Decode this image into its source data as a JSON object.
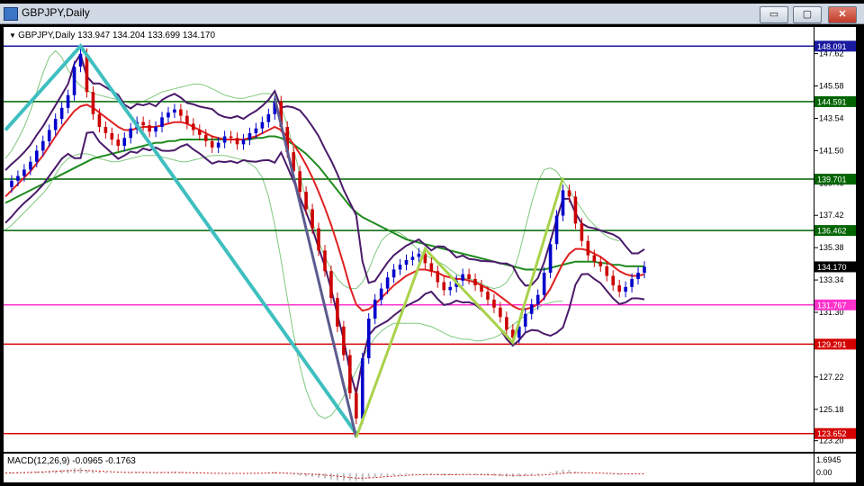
{
  "window": {
    "title": "GBPJPY,Daily",
    "buttons": {
      "minimize": "▭",
      "restore": "▢",
      "close": "✕"
    }
  },
  "chart_info": "GBPJPY,Daily  133.947 134.204 133.699 134.170",
  "macd_info": "MACD(12,26,9) -0.0965 -0.1763",
  "chart_data": {
    "type": "line",
    "symbol": "GBPJPY",
    "timeframe": "Daily",
    "ohlc": {
      "open": 133.947,
      "high": 134.204,
      "low": 133.699,
      "close": 134.17
    },
    "ylim": [
      122.5,
      149.3
    ],
    "price_ticks": [
      147.62,
      145.58,
      143.54,
      141.5,
      139.46,
      137.42,
      135.38,
      133.34,
      131.3,
      127.22,
      125.18,
      123.2
    ],
    "levels": [
      {
        "value": 148.091,
        "color": "#1a1aa0"
      },
      {
        "value": 144.591,
        "color": "#006400"
      },
      {
        "value": 139.701,
        "color": "#006400"
      },
      {
        "value": 136.462,
        "color": "#006400"
      },
      {
        "value": 134.17,
        "color": "#000000"
      },
      {
        "value": 131.767,
        "color": "#ff33cc"
      },
      {
        "value": 129.291,
        "color": "#d40000"
      },
      {
        "value": 123.652,
        "color": "#d40000"
      }
    ],
    "close_series": [
      139.2,
      139.6,
      139.9,
      140.3,
      140.8,
      141.5,
      142.1,
      142.8,
      143.5,
      144.2,
      145.0,
      146.8,
      147.6,
      145.2,
      143.8,
      143.0,
      142.6,
      142.2,
      141.8,
      142.3,
      142.9,
      143.3,
      143.1,
      142.7,
      143.0,
      143.6,
      143.9,
      144.1,
      143.7,
      143.2,
      142.8,
      142.5,
      142.1,
      141.7,
      142.0,
      142.4,
      142.3,
      141.9,
      142.2,
      142.6,
      142.9,
      143.3,
      143.8,
      144.6,
      143.0,
      141.4,
      140.2,
      138.9,
      137.8,
      136.6,
      135.2,
      133.9,
      132.2,
      130.4,
      128.6,
      126.2,
      124.6,
      128.4,
      130.9,
      132.1,
      132.8,
      133.5,
      134.0,
      134.3,
      134.6,
      134.8,
      135.0,
      134.4,
      133.9,
      133.2,
      132.7,
      132.9,
      133.3,
      133.7,
      133.4,
      133.0,
      132.6,
      132.1,
      131.6,
      131.0,
      130.2,
      129.7,
      130.4,
      131.2,
      131.8,
      132.4,
      133.8,
      135.6,
      137.4,
      139.0,
      138.6,
      136.9,
      135.8,
      134.9,
      134.5,
      134.2,
      133.6,
      133.0,
      132.6,
      132.9,
      133.4,
      133.8,
      134.17
    ],
    "ma_fast": [
      138.6,
      139.0,
      139.4,
      139.8,
      140.2,
      140.7,
      141.2,
      141.8,
      142.4,
      143.0,
      143.5,
      144.0,
      144.3,
      144.4,
      144.2,
      143.9,
      143.6,
      143.3,
      143.0,
      142.8,
      142.8,
      142.9,
      143.0,
      143.0,
      143.0,
      143.1,
      143.2,
      143.3,
      143.3,
      143.2,
      143.0,
      142.8,
      142.6,
      142.4,
      142.3,
      142.2,
      142.2,
      142.2,
      142.2,
      142.3,
      142.4,
      142.6,
      142.8,
      143.0,
      142.8,
      142.4,
      141.9,
      141.3,
      140.6,
      139.8,
      138.9,
      137.9,
      136.8,
      135.6,
      134.3,
      132.9,
      131.8,
      131.4,
      131.5,
      131.8,
      132.2,
      132.6,
      133.0,
      133.3,
      133.6,
      133.8,
      134.0,
      134.0,
      133.9,
      133.8,
      133.6,
      133.5,
      133.4,
      133.4,
      133.3,
      133.2,
      133.0,
      132.8,
      132.6,
      132.3,
      132.0,
      131.7,
      131.5,
      131.5,
      131.6,
      131.8,
      132.2,
      132.8,
      133.6,
      134.4,
      135.0,
      135.3,
      135.3,
      135.2,
      135.0,
      134.8,
      134.5,
      134.2,
      133.9,
      133.7,
      133.6,
      133.6,
      133.7
    ],
    "ma_slow": [
      138.2,
      138.4,
      138.6,
      138.8,
      139.0,
      139.2,
      139.4,
      139.6,
      139.8,
      140.0,
      140.2,
      140.4,
      140.6,
      140.8,
      141.0,
      141.1,
      141.2,
      141.3,
      141.4,
      141.5,
      141.6,
      141.7,
      141.8,
      141.9,
      142.0,
      142.0,
      142.1,
      142.1,
      142.2,
      142.2,
      142.2,
      142.2,
      142.2,
      142.2,
      142.2,
      142.2,
      142.2,
      142.2,
      142.2,
      142.2,
      142.3,
      142.3,
      142.4,
      142.4,
      142.3,
      142.1,
      141.9,
      141.6,
      141.3,
      140.9,
      140.5,
      140.0,
      139.5,
      139.0,
      138.5,
      138.0,
      137.6,
      137.3,
      137.1,
      136.9,
      136.7,
      136.5,
      136.3,
      136.1,
      135.9,
      135.8,
      135.7,
      135.6,
      135.5,
      135.4,
      135.3,
      135.2,
      135.1,
      135.0,
      134.9,
      134.8,
      134.7,
      134.6,
      134.5,
      134.4,
      134.3,
      134.2,
      134.1,
      134.0,
      134.0,
      134.0,
      134.0,
      134.1,
      134.2,
      134.3,
      134.4,
      134.5,
      134.5,
      134.5,
      134.5,
      134.4,
      134.4,
      134.3,
      134.3,
      134.2,
      134.2,
      134.2,
      134.2
    ],
    "zigzag": [
      {
        "i": 0,
        "v": 142.8
      },
      {
        "i": 12,
        "v": 148.09
      },
      {
        "i": 56,
        "v": 123.65
      }
    ],
    "zigzag_recent": [
      {
        "i": 43,
        "v": 144.8
      },
      {
        "i": 56,
        "v": 123.4
      }
    ],
    "zigzag_green": [
      {
        "i": 56,
        "v": 123.4
      },
      {
        "i": 67,
        "v": 135.3
      },
      {
        "i": 81,
        "v": 129.4
      },
      {
        "i": 89,
        "v": 139.8
      }
    ],
    "bands_upper": [
      141.0,
      141.5,
      142.2,
      143.0,
      144.0,
      145.2,
      146.4,
      147.4,
      147.8,
      147.4,
      146.6,
      146.0,
      145.6,
      145.3,
      145.1,
      145.0,
      144.9,
      144.8,
      144.7,
      144.6,
      144.5,
      144.5,
      144.6,
      144.8,
      145.0,
      145.2,
      145.3,
      145.4,
      145.5,
      145.6,
      145.7,
      145.7,
      145.6,
      145.4,
      145.2,
      145.0,
      144.9,
      144.8,
      144.8,
      144.9,
      145.0,
      145.1,
      145.1,
      145.0,
      144.3,
      143.1,
      141.6,
      140.0,
      138.4,
      137.0,
      135.8,
      134.8,
      134.0,
      133.4,
      133.0,
      132.8,
      132.8,
      133.2,
      134.0,
      135.0,
      135.8,
      136.2,
      136.4,
      136.3,
      136.0,
      135.6,
      135.2,
      134.9,
      134.7,
      134.5,
      134.3,
      134.0,
      133.7,
      133.5,
      133.4,
      133.3,
      133.1,
      132.9,
      132.8,
      132.9,
      133.2,
      133.8,
      135.0,
      136.6,
      138.2,
      139.5,
      140.3,
      140.4,
      140.2,
      139.6,
      139.0,
      138.4,
      137.8,
      137.2,
      136.8,
      136.4,
      136.1,
      135.9,
      135.8
    ],
    "bands_lower": [
      136.5,
      136.8,
      137.2,
      137.6,
      138.0,
      138.4,
      138.8,
      139.3,
      140.0,
      140.6,
      141.0,
      141.2,
      141.3,
      141.3,
      141.2,
      141.0,
      140.9,
      140.8,
      140.8,
      140.9,
      141.0,
      141.1,
      141.2,
      141.2,
      141.2,
      141.1,
      141.0,
      140.9,
      140.8,
      140.8,
      140.9,
      141.0,
      141.1,
      141.2,
      141.2,
      141.2,
      141.1,
      141.0,
      140.9,
      140.7,
      140.4,
      139.8,
      138.6,
      136.8,
      134.6,
      132.2,
      129.9,
      127.9,
      126.4,
      125.4,
      124.8,
      124.6,
      124.8,
      125.3,
      126.0,
      126.8,
      127.6,
      128.4,
      129.1,
      129.7,
      130.1,
      130.4,
      130.6,
      130.6,
      130.6,
      130.6,
      130.6,
      130.5,
      130.4,
      130.2,
      130.0,
      129.8,
      129.7,
      129.6,
      129.6,
      129.5,
      129.5,
      129.6,
      129.7,
      129.9,
      130.2,
      130.5,
      130.8,
      131.1,
      131.4,
      131.6,
      131.8,
      131.9,
      132.0,
      132.0
    ]
  }
}
